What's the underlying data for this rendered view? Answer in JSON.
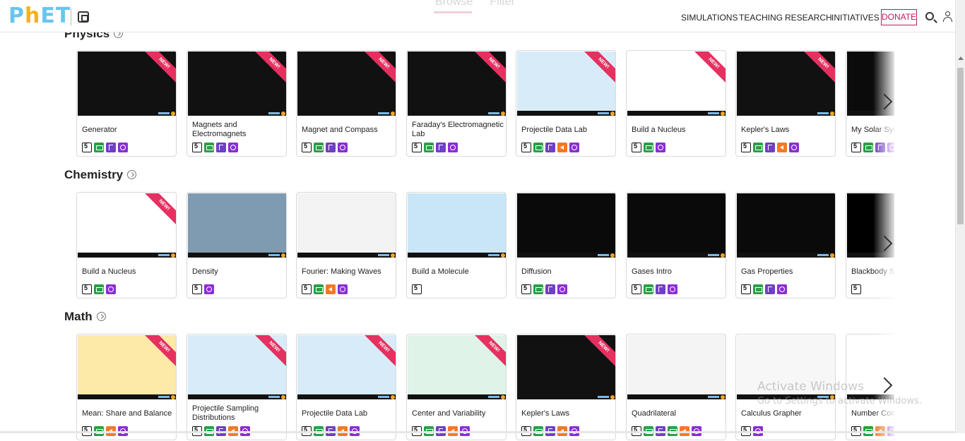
{
  "header": {
    "logo": "PhET",
    "ghost_tabs": [
      "Browse",
      "Filter"
    ],
    "nav": [
      "SIMULATIONS",
      "TEACHING",
      "RESEARCH",
      "INITIATIVES"
    ],
    "donate": "DONATE"
  },
  "sections": [
    {
      "title": "Physics",
      "cards": [
        {
          "title": "Generator",
          "isNew": true,
          "thumb": "#111111",
          "icons": [
            "html5-icon",
            "keyboard-icon",
            "touch-icon",
            "zoom-icon"
          ]
        },
        {
          "title": "Magnets and Electromagnets",
          "isNew": true,
          "thumb": "#111111",
          "icons": [
            "html5-icon",
            "keyboard-icon",
            "touch-icon",
            "zoom-icon"
          ]
        },
        {
          "title": "Magnet and Compass",
          "isNew": true,
          "thumb": "#111111",
          "icons": [
            "html5-icon",
            "keyboard-icon",
            "touch-icon",
            "zoom-icon"
          ]
        },
        {
          "title": "Faraday's Electromagnetic Lab",
          "isNew": true,
          "thumb": "#111111",
          "icons": [
            "html5-icon",
            "keyboard-icon",
            "touch-icon",
            "zoom-icon"
          ]
        },
        {
          "title": "Projectile Data Lab",
          "isNew": true,
          "thumb": "#d7ecf8",
          "icons": [
            "html5-icon",
            "keyboard-icon",
            "touch-icon",
            "sound-icon",
            "zoom-icon"
          ]
        },
        {
          "title": "Build a Nucleus",
          "isNew": true,
          "thumb": "#ffffff",
          "icons": [
            "html5-icon",
            "keyboard-icon",
            "zoom-icon"
          ]
        },
        {
          "title": "Kepler's Laws",
          "isNew": true,
          "thumb": "#111111",
          "icons": [
            "html5-icon",
            "keyboard-icon",
            "touch-icon",
            "sound-icon",
            "zoom-icon"
          ]
        },
        {
          "title": "My Solar System",
          "isNew": false,
          "thumb": "#0b0b0b",
          "icons": [
            "html5-icon",
            "keyboard-icon",
            "touch-icon",
            "zoom-icon"
          ]
        }
      ]
    },
    {
      "title": "Chemistry",
      "cards": [
        {
          "title": "Build a Nucleus",
          "isNew": true,
          "thumb": "#ffffff",
          "icons": [
            "html5-icon",
            "keyboard-icon",
            "zoom-icon"
          ]
        },
        {
          "title": "Density",
          "isNew": false,
          "thumb": "#7f9bb2",
          "icons": [
            "html5-icon",
            "zoom-icon"
          ]
        },
        {
          "title": "Fourier: Making Waves",
          "isNew": false,
          "thumb": "#f3f3f3",
          "icons": [
            "html5-icon",
            "keyboard-icon",
            "sound-icon",
            "zoom-icon"
          ]
        },
        {
          "title": "Build a Molecule",
          "isNew": false,
          "thumb": "#c9e6f6",
          "icons": [
            "html5-icon"
          ]
        },
        {
          "title": "Diffusion",
          "isNew": false,
          "thumb": "#0a0a0a",
          "icons": [
            "html5-icon",
            "keyboard-icon",
            "touch-icon",
            "zoom-icon"
          ]
        },
        {
          "title": "Gases Intro",
          "isNew": false,
          "thumb": "#0a0a0a",
          "icons": [
            "html5-icon",
            "keyboard-icon",
            "touch-icon",
            "zoom-icon"
          ]
        },
        {
          "title": "Gas Properties",
          "isNew": false,
          "thumb": "#0a0a0a",
          "icons": [
            "html5-icon",
            "keyboard-icon",
            "touch-icon",
            "zoom-icon"
          ]
        },
        {
          "title": "Blackbody Spectrum",
          "isNew": false,
          "thumb": "#000000",
          "icons": [
            "html5-icon"
          ]
        }
      ]
    },
    {
      "title": "Math",
      "cards": [
        {
          "title": "Mean: Share and Balance",
          "isNew": true,
          "thumb": "#fde9a8",
          "icons": [
            "html5-icon",
            "keyboard-icon",
            "sound-icon",
            "zoom-icon"
          ]
        },
        {
          "title": "Projectile Sampling Distributions",
          "isNew": true,
          "thumb": "#d7ecf8",
          "icons": [
            "html5-icon",
            "keyboard-icon",
            "touch-icon",
            "sound-icon",
            "zoom-icon"
          ]
        },
        {
          "title": "Projectile Data Lab",
          "isNew": true,
          "thumb": "#d7ecf8",
          "icons": [
            "html5-icon",
            "keyboard-icon",
            "touch-icon",
            "sound-icon",
            "zoom-icon"
          ]
        },
        {
          "title": "Center and Variability",
          "isNew": true,
          "thumb": "#dff3e8",
          "icons": [
            "html5-icon",
            "keyboard-icon",
            "touch-icon",
            "sound-icon",
            "zoom-icon"
          ]
        },
        {
          "title": "Kepler's Laws",
          "isNew": true,
          "thumb": "#111111",
          "icons": [
            "html5-icon",
            "keyboard-icon",
            "touch-icon",
            "sound-icon",
            "zoom-icon"
          ]
        },
        {
          "title": "Quadrilateral",
          "isNew": false,
          "thumb": "#f4f4f4",
          "icons": [
            "html5-icon",
            "keyboard-icon",
            "touch-icon",
            "keyboard-icon",
            "sound-icon",
            "zoom-icon"
          ]
        },
        {
          "title": "Calculus Grapher",
          "isNew": false,
          "thumb": "#f7f7f7",
          "icons": [
            "html5-icon",
            "zoom-icon"
          ]
        },
        {
          "title": "Number Compare",
          "isNew": false,
          "thumb": "#ffffff",
          "icons": [
            "html5-icon",
            "keyboard-icon",
            "sound-icon",
            "zoom-icon"
          ]
        }
      ]
    }
  ],
  "watermark": {
    "line1": "Activate Windows",
    "line2": "Go to Settings to activate Windows."
  }
}
